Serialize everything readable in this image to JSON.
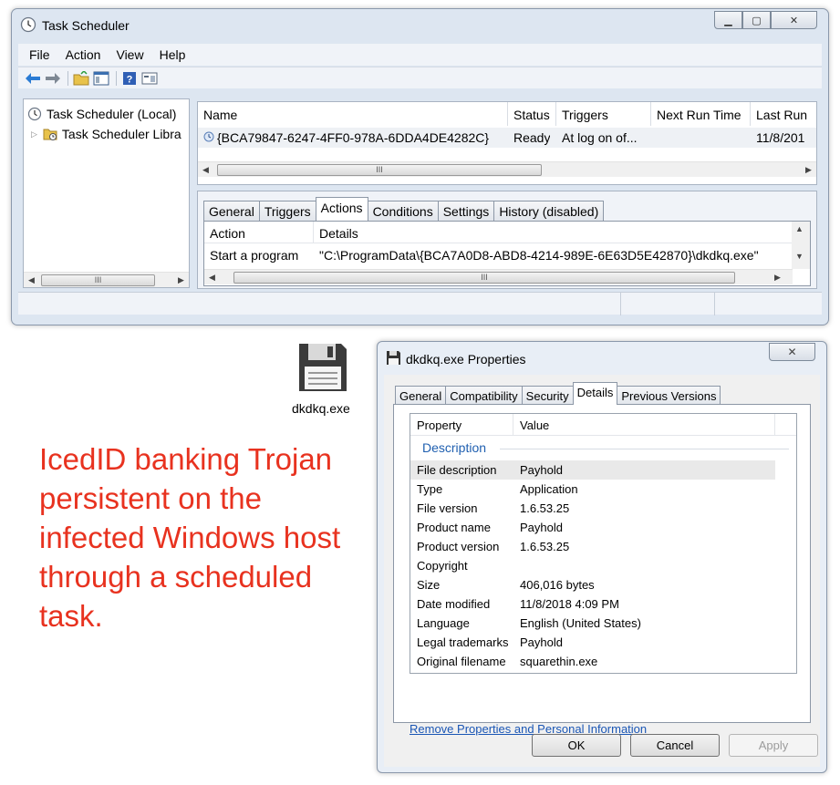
{
  "task_scheduler": {
    "title": "Task Scheduler",
    "menu": [
      "File",
      "Action",
      "View",
      "Help"
    ],
    "tree": {
      "root": "Task Scheduler (Local)",
      "library": "Task Scheduler Libra"
    },
    "table": {
      "headers": [
        "Name",
        "Status",
        "Triggers",
        "Next Run Time",
        "Last Run"
      ],
      "row": {
        "name": "{BCA79847-6247-4FF0-978A-6DDA4DE4282C}",
        "status": "Ready",
        "triggers": "At log on of...",
        "next_run": "",
        "last_run": "11/8/201"
      }
    },
    "detail_tabs": [
      "General",
      "Triggers",
      "Actions",
      "Conditions",
      "Settings",
      "History (disabled)"
    ],
    "active_tab": "Actions",
    "actions_table": {
      "headers": [
        "Action",
        "Details"
      ],
      "row": {
        "action": "Start a program",
        "details": "\"C:\\ProgramData\\{BCA7A0D8-ABD8-4214-989E-6E63D5E42870}\\dkdkq.exe\""
      }
    },
    "scroll_glyph": "III"
  },
  "desktop_icon": {
    "label": "dkdkq.exe"
  },
  "caption": "IcedID banking Trojan persistent on the infected Windows host through a scheduled task.",
  "properties": {
    "title": "dkdkq.exe Properties",
    "tabs": [
      "General",
      "Compatibility",
      "Security",
      "Details",
      "Previous Versions"
    ],
    "active_tab": "Details",
    "list_headers": [
      "Property",
      "Value"
    ],
    "group": "Description",
    "rows": [
      {
        "k": "File description",
        "v": "Payhold"
      },
      {
        "k": "Type",
        "v": "Application"
      },
      {
        "k": "File version",
        "v": "1.6.53.25"
      },
      {
        "k": "Product name",
        "v": "Payhold"
      },
      {
        "k": "Product version",
        "v": "1.6.53.25"
      },
      {
        "k": "Copyright",
        "v": ""
      },
      {
        "k": "Size",
        "v": "406,016 bytes"
      },
      {
        "k": "Date modified",
        "v": "11/8/2018 4:09 PM"
      },
      {
        "k": "Language",
        "v": "English (United States)"
      },
      {
        "k": "Legal trademarks",
        "v": "Payhold"
      },
      {
        "k": "Original filename",
        "v": "squarethin.exe"
      }
    ],
    "link": "Remove Properties and Personal Information",
    "buttons": {
      "ok": "OK",
      "cancel": "Cancel",
      "apply": "Apply"
    }
  },
  "colors": {
    "caption": "#e8321f",
    "window_frame": "#dde6f1",
    "link": "#1a56b5"
  }
}
